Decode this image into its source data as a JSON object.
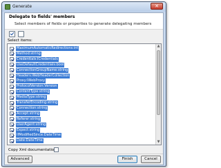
{
  "window": {
    "title": "Generate",
    "close_glyph": "✕"
  },
  "header": {
    "title": "Delegate to fields' members",
    "description": "Select members of fields or properties to generate delegating members"
  },
  "list": {
    "label": "Select items:",
    "items": [
      "MaximumAutomaticRedirections:int",
      "Method:string",
      "Credentials:ICredentials",
      "UseDefaultCredentials:bool",
      "ConnectionGroupName:string",
      "Headers:WebHeaderCollection",
      "Proxy:IWebProxy",
      "ProtocolVersion:Version",
      "ContentType:string",
      "MediaType:string",
      "TransferEncoding:string",
      "Connection:string",
      "Accept:string",
      "Referer:string",
      "UserAgent:string",
      "Expect:string",
      "IfModifiedSince:DateTime",
      "Date:DateTime"
    ]
  },
  "options": {
    "copy_xml_label": "Copy Xml documentation:",
    "copy_xml_checked": false
  },
  "buttons": {
    "advanced": "Advanced",
    "finish": "Finish",
    "cancel": "Cancel"
  },
  "icons": {
    "app": "generate-icon",
    "check_all": "check-all-icon",
    "uncheck_all": "uncheck-all-icon",
    "scroll_up": "scroll-up-arrow-icon",
    "scroll_down": "scroll-down-arrow-icon"
  },
  "colors": {
    "selection": "#3a7bd5",
    "title_bar": "#c7d8ee",
    "dialog_bg": "#f0f0f0"
  }
}
